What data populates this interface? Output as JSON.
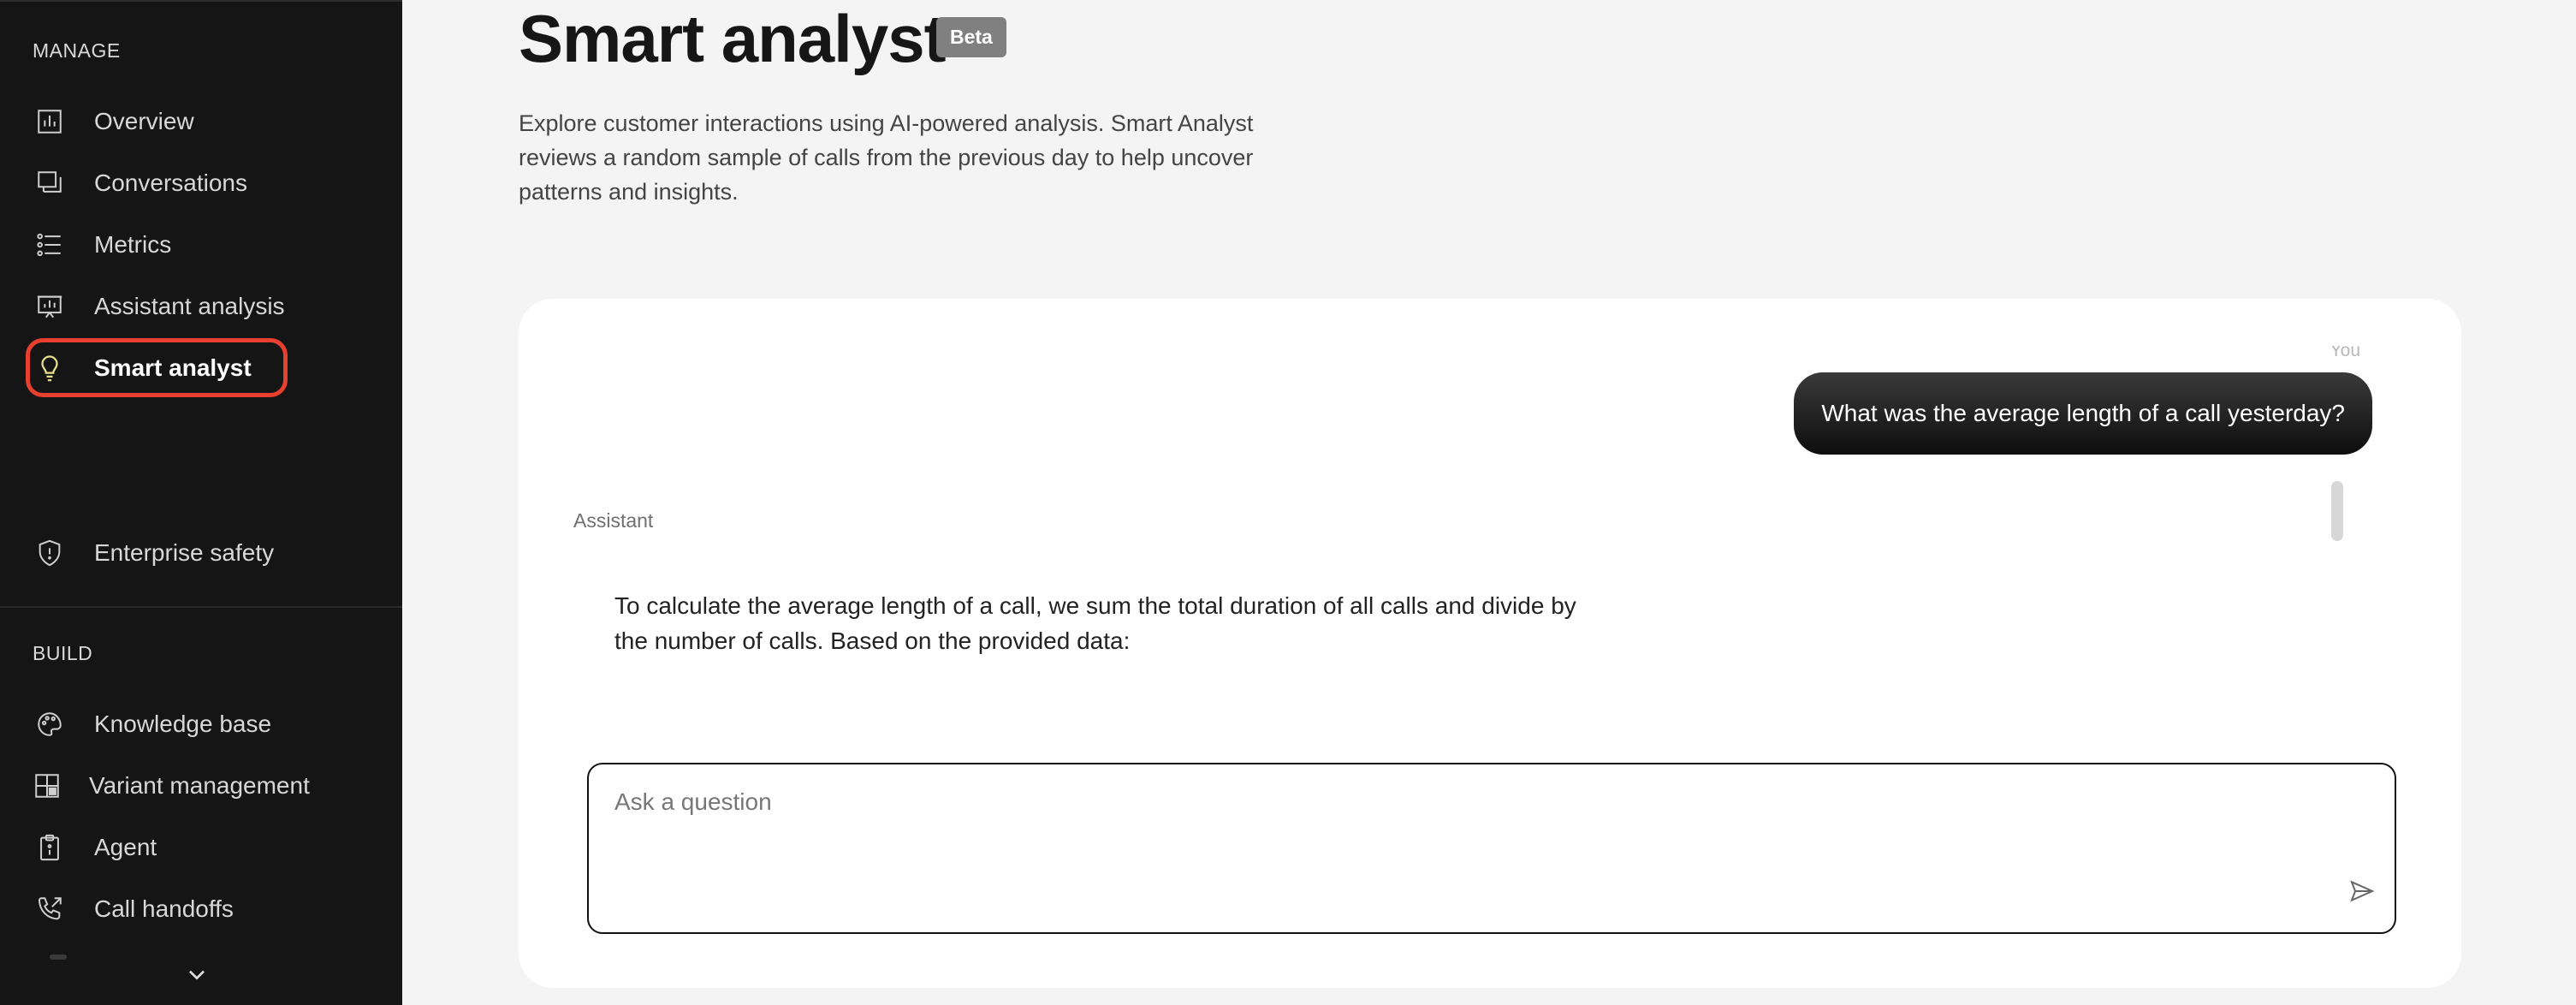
{
  "sidebar": {
    "manage_label": "MANAGE",
    "build_label": "BUILD",
    "manage_items": [
      {
        "label": "Overview",
        "icon": "bar-chart-icon"
      },
      {
        "label": "Conversations",
        "icon": "chat-bubbles-icon"
      },
      {
        "label": "Metrics",
        "icon": "list-icon"
      },
      {
        "label": "Assistant analysis",
        "icon": "presentation-icon"
      },
      {
        "label": "Smart analyst",
        "icon": "lightbulb-icon",
        "active": true
      },
      {
        "label": "Enterprise safety",
        "icon": "shield-icon"
      }
    ],
    "build_items": [
      {
        "label": "Knowledge base",
        "icon": "palette-icon"
      },
      {
        "label": "Variant management",
        "icon": "grid-icon"
      },
      {
        "label": "Agent",
        "icon": "clipboard-icon"
      },
      {
        "label": "Call handoffs",
        "icon": "phone-forward-icon"
      }
    ]
  },
  "header": {
    "title": "Smart analyst",
    "badge": "Beta",
    "description": "Explore customer interactions using AI-powered analysis. Smart Analyst reviews a random sample of calls from the previous day to help uncover patterns and insights."
  },
  "chat": {
    "you_label": "You",
    "user_message": "What was the average length of a call yesterday?",
    "assistant_label": "Assistant",
    "assistant_message": "To calculate the average length of a call, we sum the total duration of all calls and divide by the number of calls. Based on the provided data:",
    "input_placeholder": "Ask a question"
  },
  "colors": {
    "sidebar_bg": "#151515",
    "active_highlight": "#e8402f",
    "active_icon": "#e6e08a",
    "page_bg": "#f4f4f4"
  }
}
